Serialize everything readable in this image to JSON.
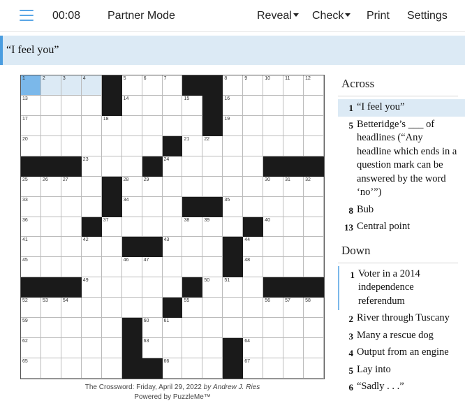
{
  "toolbar": {
    "timer": "00:08",
    "partner_mode": "Partner Mode",
    "reveal": "Reveal",
    "check": "Check",
    "print": "Print",
    "settings": "Settings"
  },
  "current_clue": "“I feel you”",
  "grid": {
    "size": 15,
    "active_cell": [
      0,
      0
    ],
    "highlight_cells": [
      [
        0,
        0
      ],
      [
        0,
        1
      ],
      [
        0,
        2
      ],
      [
        0,
        3
      ]
    ],
    "black_cells": [
      [
        0,
        4
      ],
      [
        0,
        8
      ],
      [
        0,
        9
      ],
      [
        1,
        4
      ],
      [
        1,
        9
      ],
      [
        2,
        9
      ],
      [
        3,
        7
      ],
      [
        4,
        0
      ],
      [
        4,
        1
      ],
      [
        4,
        2
      ],
      [
        4,
        6
      ],
      [
        4,
        12
      ],
      [
        4,
        13
      ],
      [
        4,
        14
      ],
      [
        5,
        4
      ],
      [
        6,
        4
      ],
      [
        6,
        8
      ],
      [
        6,
        9
      ],
      [
        7,
        3
      ],
      [
        7,
        11
      ],
      [
        8,
        5
      ],
      [
        8,
        6
      ],
      [
        8,
        10
      ],
      [
        9,
        10
      ],
      [
        10,
        0
      ],
      [
        10,
        1
      ],
      [
        10,
        2
      ],
      [
        10,
        8
      ],
      [
        10,
        12
      ],
      [
        10,
        13
      ],
      [
        10,
        14
      ],
      [
        11,
        7
      ],
      [
        12,
        5
      ],
      [
        13,
        5
      ],
      [
        13,
        10
      ],
      [
        14,
        5
      ],
      [
        14,
        6
      ],
      [
        14,
        10
      ]
    ],
    "numbers": [
      {
        "r": 0,
        "c": 0,
        "n": "1"
      },
      {
        "r": 0,
        "c": 1,
        "n": "2"
      },
      {
        "r": 0,
        "c": 2,
        "n": "3"
      },
      {
        "r": 0,
        "c": 3,
        "n": "4"
      },
      {
        "r": 0,
        "c": 5,
        "n": "5"
      },
      {
        "r": 0,
        "c": 6,
        "n": "6"
      },
      {
        "r": 0,
        "c": 7,
        "n": "7"
      },
      {
        "r": 0,
        "c": 10,
        "n": "8"
      },
      {
        "r": 0,
        "c": 11,
        "n": "9"
      },
      {
        "r": 0,
        "c": 12,
        "n": "10"
      },
      {
        "r": 0,
        "c": 13,
        "n": "11"
      },
      {
        "r": 0,
        "c": 14,
        "n": "12"
      },
      {
        "r": 1,
        "c": 0,
        "n": "13"
      },
      {
        "r": 1,
        "c": 5,
        "n": "14"
      },
      {
        "r": 1,
        "c": 8,
        "n": "15"
      },
      {
        "r": 1,
        "c": 10,
        "n": "16"
      },
      {
        "r": 2,
        "c": 0,
        "n": "17"
      },
      {
        "r": 2,
        "c": 4,
        "n": "18"
      },
      {
        "r": 2,
        "c": 10,
        "n": "19"
      },
      {
        "r": 3,
        "c": 0,
        "n": "20"
      },
      {
        "r": 3,
        "c": 8,
        "n": "21"
      },
      {
        "r": 3,
        "c": 9,
        "n": "22"
      },
      {
        "r": 4,
        "c": 3,
        "n": "23"
      },
      {
        "r": 4,
        "c": 7,
        "n": "24"
      },
      {
        "r": 5,
        "c": 0,
        "n": "25"
      },
      {
        "r": 5,
        "c": 1,
        "n": "26"
      },
      {
        "r": 5,
        "c": 2,
        "n": "27"
      },
      {
        "r": 5,
        "c": 5,
        "n": "28"
      },
      {
        "r": 5,
        "c": 6,
        "n": "29"
      },
      {
        "r": 5,
        "c": 12,
        "n": "30"
      },
      {
        "r": 5,
        "c": 13,
        "n": "31"
      },
      {
        "r": 5,
        "c": 14,
        "n": "32"
      },
      {
        "r": 6,
        "c": 0,
        "n": "33"
      },
      {
        "r": 6,
        "c": 5,
        "n": "34"
      },
      {
        "r": 6,
        "c": 10,
        "n": "35"
      },
      {
        "r": 7,
        "c": 0,
        "n": "36"
      },
      {
        "r": 7,
        "c": 4,
        "n": "37"
      },
      {
        "r": 7,
        "c": 8,
        "n": "38"
      },
      {
        "r": 7,
        "c": 9,
        "n": "39"
      },
      {
        "r": 7,
        "c": 12,
        "n": "40"
      },
      {
        "r": 8,
        "c": 0,
        "n": "41"
      },
      {
        "r": 8,
        "c": 3,
        "n": "42"
      },
      {
        "r": 8,
        "c": 7,
        "n": "43"
      },
      {
        "r": 8,
        "c": 11,
        "n": "44"
      },
      {
        "r": 9,
        "c": 0,
        "n": "45"
      },
      {
        "r": 9,
        "c": 5,
        "n": "46"
      },
      {
        "r": 9,
        "c": 6,
        "n": "47"
      },
      {
        "r": 9,
        "c": 11,
        "n": "48"
      },
      {
        "r": 10,
        "c": 3,
        "n": "49"
      },
      {
        "r": 10,
        "c": 9,
        "n": "50"
      },
      {
        "r": 10,
        "c": 10,
        "n": "51"
      },
      {
        "r": 11,
        "c": 0,
        "n": "52"
      },
      {
        "r": 11,
        "c": 1,
        "n": "53"
      },
      {
        "r": 11,
        "c": 2,
        "n": "54"
      },
      {
        "r": 11,
        "c": 8,
        "n": "55"
      },
      {
        "r": 11,
        "c": 12,
        "n": "56"
      },
      {
        "r": 11,
        "c": 13,
        "n": "57"
      },
      {
        "r": 11,
        "c": 14,
        "n": "58"
      },
      {
        "r": 12,
        "c": 0,
        "n": "59"
      },
      {
        "r": 12,
        "c": 6,
        "n": "60"
      },
      {
        "r": 12,
        "c": 7,
        "n": "61"
      },
      {
        "r": 13,
        "c": 0,
        "n": "62"
      },
      {
        "r": 13,
        "c": 6,
        "n": "63"
      },
      {
        "r": 13,
        "c": 11,
        "n": "64"
      },
      {
        "r": 14,
        "c": 0,
        "n": "65"
      },
      {
        "r": 14,
        "c": 7,
        "n": "66"
      },
      {
        "r": 14,
        "c": 11,
        "n": "67"
      }
    ]
  },
  "credit": {
    "prefix": "The Crossword: Friday, April 29, 2022 ",
    "by": "by",
    "author": "Andrew J. Ries",
    "powered_prefix": "Powered by ",
    "powered_brand": "PuzzleMe™"
  },
  "clues": {
    "across_title": "Across",
    "across": [
      {
        "num": "1",
        "text": "“I feel you”"
      },
      {
        "num": "5",
        "text": "Betteridge’s ___ of headlines (“Any headline which ends in a question mark can be answered by the word ‘no’”)"
      },
      {
        "num": "8",
        "text": "Bub"
      },
      {
        "num": "13",
        "text": "Central point"
      }
    ],
    "down_title": "Down",
    "down": [
      {
        "num": "1",
        "text": "Voter in a 2014 independence referendum"
      },
      {
        "num": "2",
        "text": "River through Tuscany"
      },
      {
        "num": "3",
        "text": "Many a rescue dog"
      },
      {
        "num": "4",
        "text": "Output from an engine"
      },
      {
        "num": "5",
        "text": "Lay into"
      },
      {
        "num": "6",
        "text": "“Sadly . . .”"
      }
    ]
  },
  "colors": {
    "accent": "#4a9de0",
    "highlight": "#dceaf5",
    "active_cell": "#7bb8ea",
    "black_square": "#1a1a1a"
  }
}
